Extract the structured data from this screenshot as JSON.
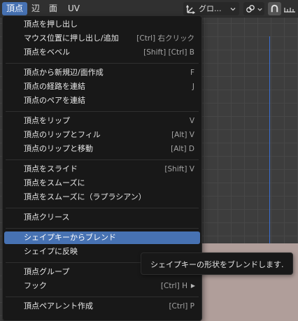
{
  "header": {
    "tabs": [
      {
        "label": "頂点",
        "active": true
      },
      {
        "label": "辺",
        "active": false
      },
      {
        "label": "面",
        "active": false
      },
      {
        "label": "UV",
        "active": false
      }
    ],
    "transform_orientation": "グロ...",
    "icons": [
      "transform-gizmo-icon",
      "dropdown-arrow-icon",
      "link-icon",
      "snap-magnet-icon",
      "snap-increment-icon"
    ]
  },
  "menu": {
    "groups": [
      [
        {
          "label": "頂点を押し出し",
          "shortcut": ""
        },
        {
          "label": "マウス位置に押し出し/追加",
          "shortcut": "[Ctrl] 右クリック"
        },
        {
          "label": "頂点をベベル",
          "shortcut": "[Shift] [Ctrl] B"
        }
      ],
      [
        {
          "label": "頂点から新規辺/面作成",
          "shortcut": "F"
        },
        {
          "label": "頂点の経路を連結",
          "shortcut": "J"
        },
        {
          "label": "頂点のペアを連結",
          "shortcut": ""
        }
      ],
      [
        {
          "label": "頂点をリップ",
          "shortcut": "V"
        },
        {
          "label": "頂点のリップとフィル",
          "shortcut": "[Alt] V"
        },
        {
          "label": "頂点のリップと移動",
          "shortcut": "[Alt] D"
        }
      ],
      [
        {
          "label": "頂点をスライド",
          "shortcut": "[Shift] V"
        },
        {
          "label": "頂点をスムーズに",
          "shortcut": ""
        },
        {
          "label": "頂点をスムーズに（ラプラシアン）",
          "shortcut": ""
        }
      ],
      [
        {
          "label": "頂点クリース",
          "shortcut": ""
        }
      ],
      [
        {
          "label": "シェイプキーからブレンド",
          "shortcut": "",
          "highlighted": true
        },
        {
          "label": "シェイプに反映",
          "shortcut": ""
        }
      ],
      [
        {
          "label": "頂点グループ",
          "shortcut": ""
        },
        {
          "label": "フック",
          "shortcut": "[Ctrl] H",
          "submenu": true
        }
      ],
      [
        {
          "label": "頂点ペアレント作成",
          "shortcut": "[Ctrl] P"
        }
      ]
    ]
  },
  "tooltip": {
    "text": "シェイプキーの形状をブレンドします."
  },
  "colors": {
    "accent": "#4772b3",
    "menu_bg": "#181818",
    "viewport_bg": "#3d3d3d",
    "axis_y": "#3b6fd3"
  }
}
